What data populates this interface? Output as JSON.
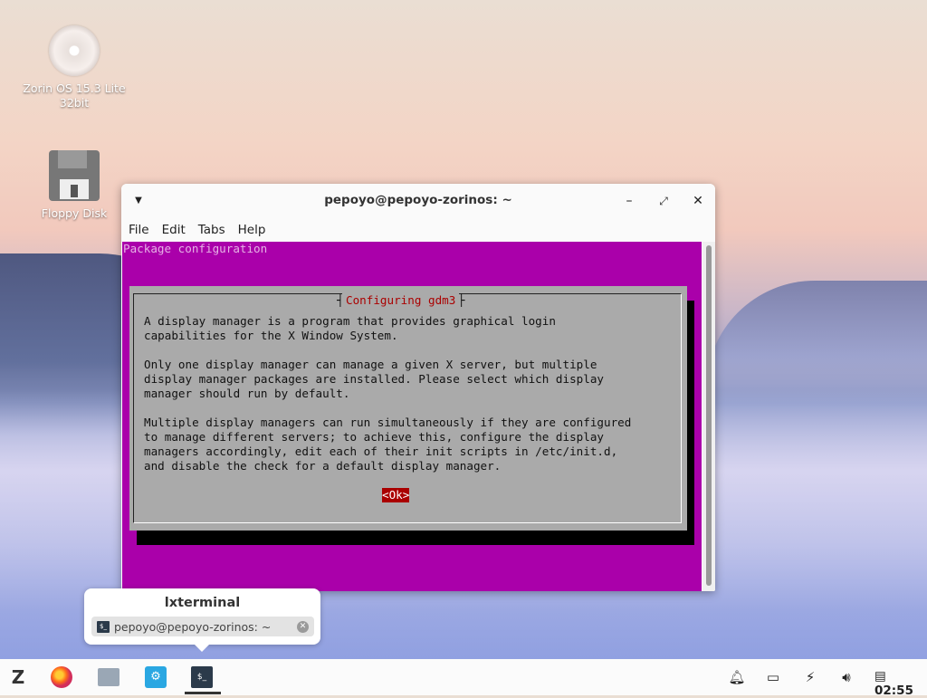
{
  "desktop": {
    "icons": [
      {
        "label_line1": "Zorin OS 15.3 Lite",
        "label_line2": "32bit"
      },
      {
        "label_line1": "Floppy Disk",
        "label_line2": ""
      }
    ]
  },
  "terminal_window": {
    "title": "pepoyo@pepoyo-zorinos: ~",
    "menu": [
      "File",
      "Edit",
      "Tabs",
      "Help"
    ],
    "content": {
      "header": "Package configuration",
      "dialog_title": "Configuring gdm3",
      "dialog_text": "A display manager is a program that provides graphical login\ncapabilities for the X Window System.\n\nOnly one display manager can manage a given X server, but multiple\ndisplay manager packages are installed. Please select which display\nmanager should run by default.\n\nMultiple display managers can run simultaneously if they are configured\nto manage different servers; to achieve this, configure the display\nmanagers accordingly, edit each of their init scripts in /etc/init.d,\nand disable the check for a default display manager.",
      "ok_button": "<Ok>"
    }
  },
  "taskbar_popup": {
    "app_name": "lxterminal",
    "window_item": "pepoyo@pepoyo-zorinos: ~"
  },
  "taskbar": {
    "clock": "02:55"
  }
}
